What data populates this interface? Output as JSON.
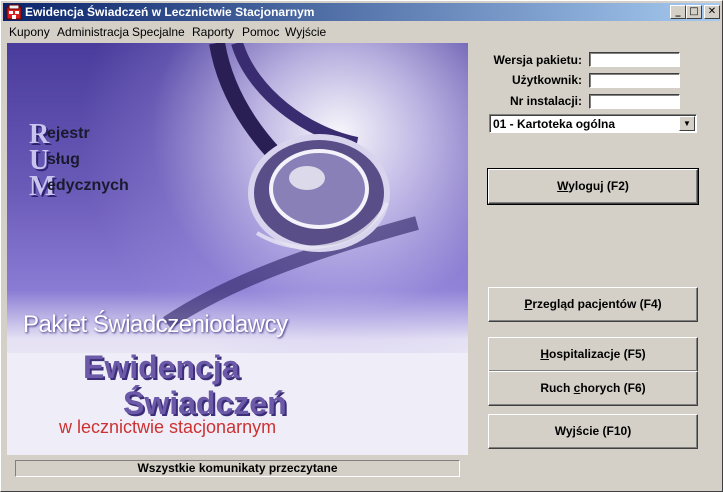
{
  "window": {
    "title": "Ewidencja Świadczeń w Lecznictwie Stacjonarnym",
    "controls": {
      "minimize": "_",
      "maximize": "□",
      "close": "✕"
    }
  },
  "menu": [
    "Kupony",
    "Administracja",
    "Specjalne",
    "Raporty",
    "Pomoc",
    "Wyjście"
  ],
  "logo": {
    "letters": [
      "R",
      "U",
      "M"
    ],
    "words": [
      "ejestr",
      "sług",
      "edycznych"
    ]
  },
  "banner": {
    "product": "Pakiet Świadczeniodawcy",
    "line1": "Ewidencja",
    "line2": "Świadczeń",
    "line3": "w lecznictwie stacjonarnym"
  },
  "form": {
    "version_label": "Wersja pakietu:",
    "version_value": "",
    "user_label": "Użytkownik:",
    "user_value": "",
    "install_label": "Nr instalacji:",
    "install_value": "",
    "registry_selected": "01 - Kartoteka ogólna"
  },
  "buttons": {
    "logout": {
      "pre": "",
      "key": "W",
      "post": "yloguj (F2)"
    },
    "patients": {
      "pre": "",
      "key": "P",
      "post": "rzegląd pacjentów (F4)"
    },
    "hosp": {
      "pre": "",
      "key": "H",
      "post": "ospitalizacje (F5)"
    },
    "movement": {
      "pre": "Ruch ",
      "key": "c",
      "post": "horych (F6)"
    },
    "exit": {
      "pre": "Wyjście (F10)",
      "key": "",
      "post": ""
    }
  },
  "status": "Wszystkie komunikaty przeczytane",
  "colors": {
    "title_start": "#0a246a",
    "title_end": "#a6caf0",
    "face": "#d4d0c8",
    "accent_red": "#cc3232"
  }
}
